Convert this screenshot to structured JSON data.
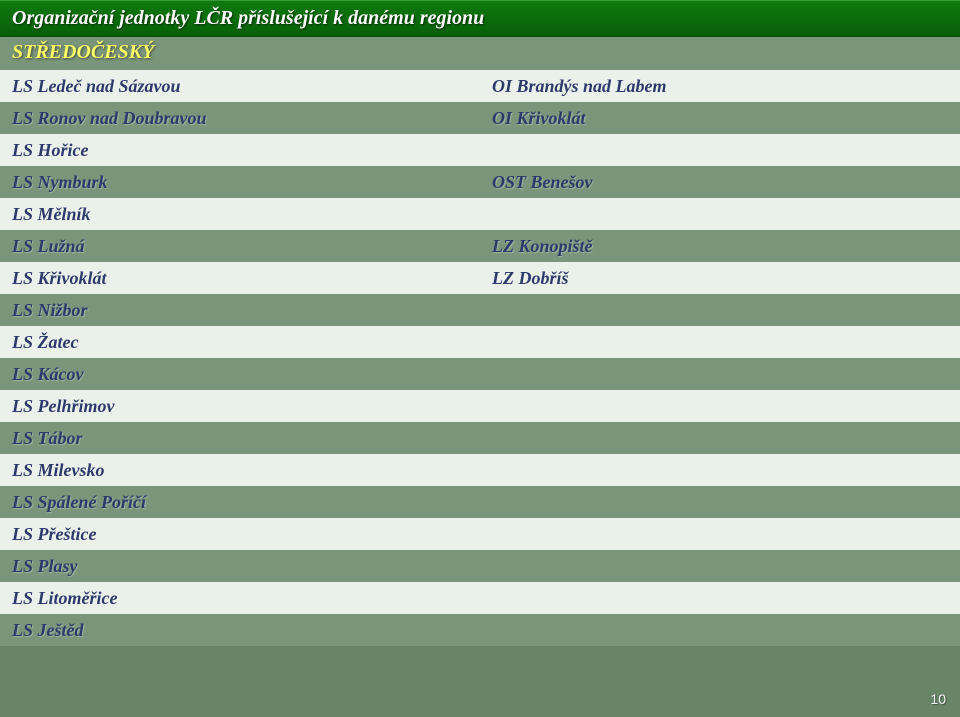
{
  "header": {
    "title": "Organizační jednotky LČR příslušející k danému regionu"
  },
  "region": "STŘEDOČESKÝ",
  "rows": [
    {
      "left": "LS Ledeč nad Sázavou",
      "right": "OI Brandýs nad Labem"
    },
    {
      "left": "LS Ronov nad Doubravou",
      "right": "OI Křivoklát"
    },
    {
      "left": "LS Hořice",
      "right": ""
    },
    {
      "left": "LS Nymburk",
      "right": "OST Benešov"
    },
    {
      "left": "LS Mělník",
      "right": ""
    },
    {
      "left": "LS Lužná",
      "right": "LZ Konopiště"
    },
    {
      "left": "LS Křivoklát",
      "right": "LZ Dobříš"
    },
    {
      "left": "LS Nižbor",
      "right": ""
    },
    {
      "left": "LS Žatec",
      "right": ""
    },
    {
      "left": "LS Kácov",
      "right": ""
    },
    {
      "left": "LS Pelhřimov",
      "right": ""
    },
    {
      "left": "LS Tábor",
      "right": ""
    },
    {
      "left": "LS Milevsko",
      "right": ""
    },
    {
      "left": "LS Spálené Poříčí",
      "right": ""
    },
    {
      "left": "LS Přeštice",
      "right": ""
    },
    {
      "left": "LS Plasy",
      "right": ""
    },
    {
      "left": "LS Litoměřice",
      "right": ""
    },
    {
      "left": "LS Ještěd",
      "right": ""
    }
  ],
  "page_number": "10"
}
